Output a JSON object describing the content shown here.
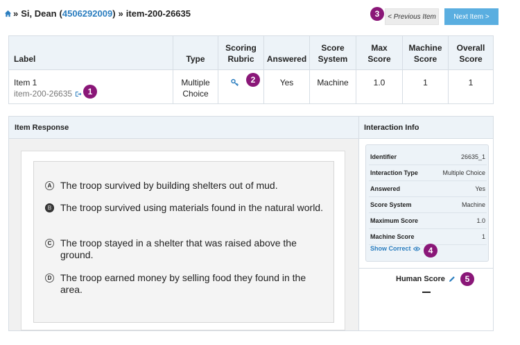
{
  "breadcrumb": {
    "name": "Si, Dean",
    "id_link": "4506292009",
    "item": "item-200-26635",
    "sep": "»",
    "open_paren": "(",
    "close_paren": ")"
  },
  "nav": {
    "prev_label": "< Previous Item",
    "next_label": "Next Item >"
  },
  "badges": {
    "b1": "1",
    "b2": "2",
    "b3": "3",
    "b4": "4",
    "b5": "5"
  },
  "summary_table": {
    "headers": {
      "label": "Label",
      "type": "Type",
      "rubric_line1": "Scoring",
      "rubric_line2": "Rubric",
      "answered": "Answered",
      "system_line1": "Score",
      "system_line2": "System",
      "max_line1": "Max",
      "max_line2": "Score",
      "machine_line1": "Machine",
      "machine_line2": "Score",
      "overall_line1": "Overall",
      "overall_line2": "Score"
    },
    "row": {
      "label": "Item 1",
      "item_id": "item-200-26635",
      "type_line1": "Multiple",
      "type_line2": "Choice",
      "answered": "Yes",
      "score_system": "Machine",
      "max_score": "1.0",
      "machine_score": "1",
      "overall_score": "1"
    }
  },
  "response_panel": {
    "title": "Item Response",
    "options": [
      {
        "letter": "A",
        "text": "The troop survived by building shelters out of mud.",
        "selected": false
      },
      {
        "letter": "B",
        "text": "The troop survived using materials found in the natural world.",
        "selected": true
      },
      {
        "letter": "C",
        "text": "The troop stayed in a shelter that was raised above the ground.",
        "selected": false
      },
      {
        "letter": "D",
        "text": "The troop earned money by selling food they found in the area.",
        "selected": false
      }
    ]
  },
  "interaction_info": {
    "title": "Interaction Info",
    "rows": [
      {
        "key": "Identifier",
        "value": "26635_1"
      },
      {
        "key": "Interaction Type",
        "value": "Multiple Choice"
      },
      {
        "key": "Answered",
        "value": "Yes"
      },
      {
        "key": "Score System",
        "value": "Machine"
      },
      {
        "key": "Maximum Score",
        "value": "1.0"
      },
      {
        "key": "Machine Score",
        "value": "1"
      }
    ],
    "show_correct": "Show Correct",
    "human_score_label": "Human Score"
  },
  "colors": {
    "badge": "#8a1778",
    "link": "#2a7dbf",
    "next_button": "#5aaee0",
    "header_bg": "#edf3f8"
  },
  "icons": [
    "home-icon",
    "exit-icon",
    "key-icon",
    "eye-icon",
    "pencil-icon"
  ]
}
